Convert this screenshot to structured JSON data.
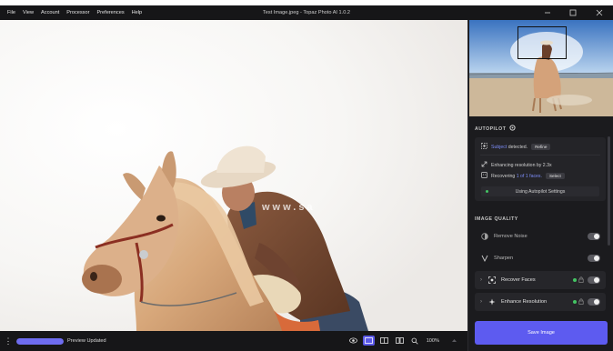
{
  "window": {
    "title": "Test Image.jpeg - Topaz Photo AI 1.0.2",
    "menu": [
      "File",
      "View",
      "Account",
      "Processor",
      "Preferences",
      "Help"
    ]
  },
  "canvas": {
    "watermark_text": "www.sa"
  },
  "bottom_bar": {
    "progress_fraction": 1.0,
    "status_label": "Preview Updated",
    "zoom_label": "100%"
  },
  "panel": {
    "autopilot": {
      "title": "AUTOPILOT",
      "subject_link": "Subject",
      "subject_rest": "detected.",
      "refine_label": "Refine",
      "enhancing_text": "Enhancing resolution by 2.3x",
      "recovering_prefix": "Recovering",
      "recovering_link": "1 of 1 faces.",
      "select_label": "Select",
      "settings_label": "Using Autopilot Settings"
    },
    "image_quality": {
      "title": "IMAGE QUALITY",
      "items": [
        {
          "label": "Remove Noise"
        },
        {
          "label": "Sharpen"
        },
        {
          "label": "Recover Faces"
        },
        {
          "label": "Enhance Resolution"
        }
      ]
    },
    "save_label": "Save Image"
  },
  "colors": {
    "accent": "#5d5bf0",
    "link": "#7c8cf6",
    "status_green": "#43c463",
    "background": "#1b1b1e"
  },
  "icons": [
    "three-dots-icon",
    "eye-icon",
    "single-view-icon",
    "split-view-icon",
    "side-by-side-icon",
    "zoom-icon",
    "chevron-up-icon",
    "gear-icon",
    "subject-icon",
    "resize-icon",
    "face-icon",
    "lock-icon",
    "noise-icon",
    "sharpen-icon",
    "recover-faces-icon",
    "enhance-icon",
    "minimize-icon",
    "maximize-icon",
    "close-icon"
  ]
}
